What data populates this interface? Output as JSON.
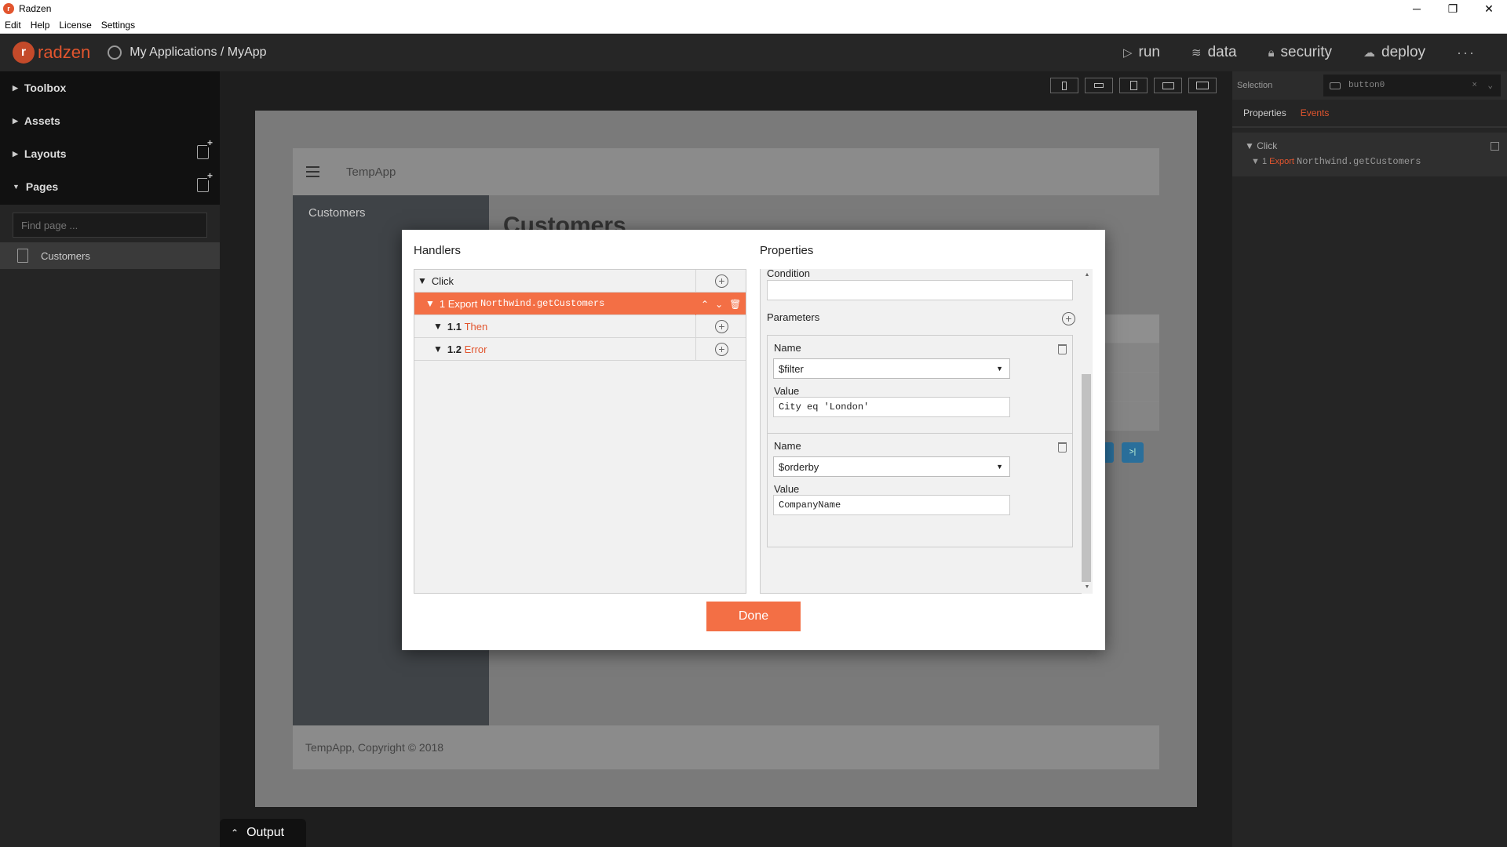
{
  "window": {
    "title": "Radzen",
    "controls": [
      "─",
      "❐",
      "✕"
    ]
  },
  "menu": [
    "Edit",
    "Help",
    "License",
    "Settings"
  ],
  "header": {
    "logo_text": "radzen",
    "breadcrumb": "My Applications / MyApp",
    "nav": [
      {
        "label": "run",
        "icon": "play-icon"
      },
      {
        "label": "data",
        "icon": "layers-icon"
      },
      {
        "label": "security",
        "icon": "lock-icon"
      },
      {
        "label": "deploy",
        "icon": "cloud-upload-icon"
      }
    ],
    "more": "···"
  },
  "sidebar": {
    "sections": [
      "Toolbox",
      "Assets",
      "Layouts",
      "Pages"
    ],
    "find_placeholder": "Find page ...",
    "pages": [
      "Customers"
    ]
  },
  "output_tab": "Output",
  "canvas": {
    "app_name": "TempApp",
    "nav_item": "Customers",
    "page_title": "Customers",
    "pager_label": ">|",
    "footer": "TempApp, Copyright © 2018"
  },
  "right_panel": {
    "selection_label": "Selection",
    "selection_value": "button0",
    "tabs": [
      "Properties",
      "Events"
    ],
    "active_tab": "Events",
    "event_name": "Click",
    "event_index": "1",
    "event_action": "Export",
    "event_method": "Northwind.getCustomers"
  },
  "modal": {
    "handlers_title": "Handlers",
    "properties_title": "Properties",
    "handlers": {
      "click": "Click",
      "item1_index": "1",
      "item1_action": "Export",
      "item1_method": "Northwind.getCustomers",
      "then_index": "1.1",
      "then_label": "Then",
      "error_index": "1.2",
      "error_label": "Error"
    },
    "properties": {
      "condition_label": "Condition",
      "condition_value": "",
      "parameters_label": "Parameters",
      "params": [
        {
          "name_label": "Name",
          "name": "$filter",
          "value_label": "Value",
          "value": "City eq 'London'"
        },
        {
          "name_label": "Name",
          "name": "$orderby",
          "value_label": "Value",
          "value": "CompanyName"
        }
      ]
    },
    "done": "Done"
  },
  "colors": {
    "accent": "#e2552e",
    "selected_row": "#f36f45"
  }
}
